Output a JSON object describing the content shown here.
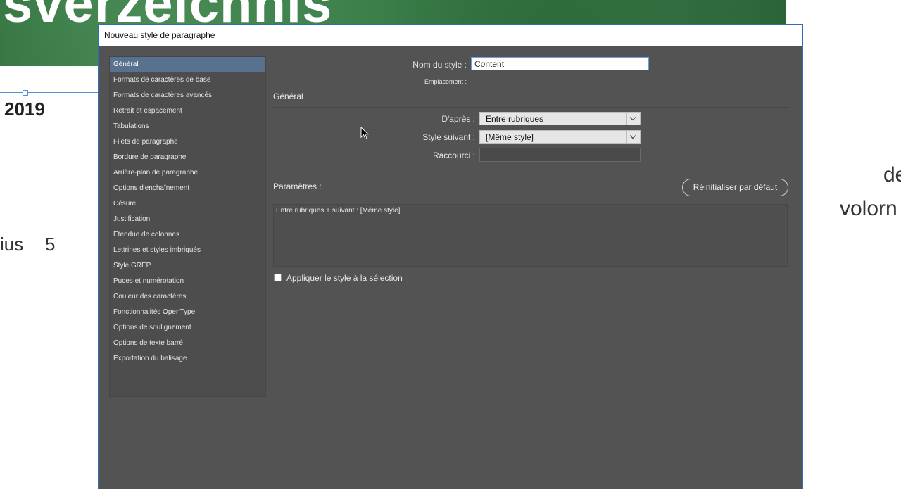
{
  "background": {
    "banner_text": "sverzeichnis",
    "year": "2019",
    "left_text": "ius",
    "left_number": "5",
    "right_text_1": "de",
    "right_text_2": "volorn"
  },
  "dialog": {
    "title": "Nouveau style de paragraphe",
    "nav": {
      "items": [
        {
          "label": "Général",
          "selected": true
        },
        {
          "label": "Formats de caractères de base"
        },
        {
          "label": "Formats de caractères avancés"
        },
        {
          "label": "Retrait et espacement"
        },
        {
          "label": "Tabulations"
        },
        {
          "label": "Filets de paragraphe"
        },
        {
          "label": "Bordure de paragraphe"
        },
        {
          "label": "Arrière-plan de paragraphe"
        },
        {
          "label": "Options d'enchaînement"
        },
        {
          "label": "Césure"
        },
        {
          "label": "Justification"
        },
        {
          "label": "Etendue de colonnes"
        },
        {
          "label": "Lettrines et styles imbriqués"
        },
        {
          "label": "Style GREP"
        },
        {
          "label": "Puces et numérotation"
        },
        {
          "label": "Couleur des caractères"
        },
        {
          "label": "Fonctionnalités OpenType"
        },
        {
          "label": "Options de soulignement"
        },
        {
          "label": "Options de texte barré"
        },
        {
          "label": "Exportation du balisage"
        }
      ]
    },
    "style_name_label": "Nom du style :",
    "style_name_value": "Content",
    "location_label": "Emplacement :",
    "section_title": "Général",
    "based_on_label": "D'après :",
    "based_on_value": "Entre rubriques",
    "next_style_label": "Style suivant :",
    "next_style_value": "[Même style]",
    "shortcut_label": "Raccourci :",
    "shortcut_value": "",
    "params_label": "Paramètres :",
    "reset_button": "Réinitialiser par défaut",
    "params_text": "Entre rubriques + suivant : [Même style]",
    "apply_checkbox_label": "Appliquer le style à la sélection",
    "apply_checked": false
  },
  "colors": {
    "dialog_bg": "#535353",
    "selected_nav": "#58718f",
    "accent_border": "#2f6fb5"
  }
}
